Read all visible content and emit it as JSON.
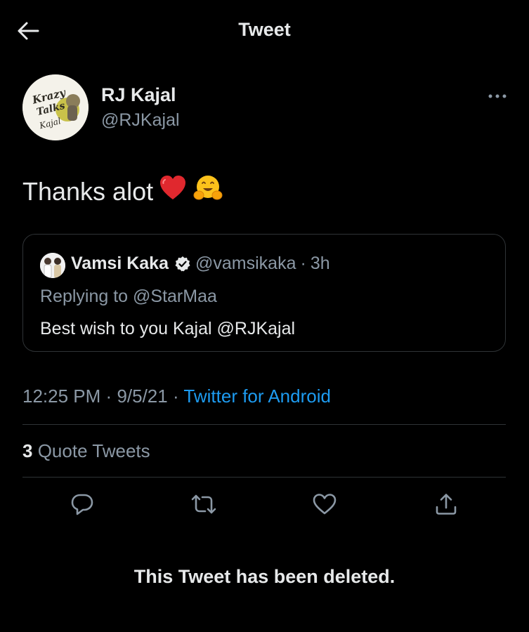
{
  "header": {
    "title": "Tweet",
    "back_icon": "arrow-left-icon"
  },
  "author": {
    "name": "RJ Kajal",
    "handle": "@RJKajal",
    "avatar_text": [
      "Krazy",
      "Talks",
      "Kajal"
    ]
  },
  "tweet": {
    "text": "Thanks alot",
    "emojis": [
      "red-heart-icon",
      "hugging-face-icon"
    ]
  },
  "quoted": {
    "name": "Vamsi Kaka",
    "handle": "@vamsikaka",
    "separator": "·",
    "time": "3h",
    "replying_to": "Replying to @StarMaa",
    "text": "Best wish to you Kajal @RJKajal"
  },
  "meta": {
    "time": "12:25 PM",
    "separator1": "·",
    "date": "9/5/21",
    "separator2": "·",
    "source": "Twitter for Android"
  },
  "stats": {
    "quote_count": "3",
    "quote_label": "Quote Tweets"
  },
  "actions": [
    "reply-icon",
    "retweet-icon",
    "like-icon",
    "share-icon"
  ],
  "footer": {
    "deleted_note": "This Tweet has been deleted."
  },
  "colors": {
    "background": "#000000",
    "primary_text": "#e7e9ea",
    "secondary_text": "#8b98a5",
    "link": "#1d9bf0",
    "border": "#2f3336",
    "verified_badge": "#e7e9ea"
  }
}
